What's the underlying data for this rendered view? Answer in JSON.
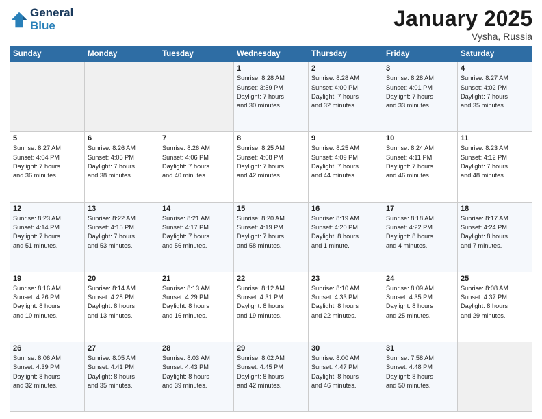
{
  "logo": {
    "line1": "General",
    "line2": "Blue"
  },
  "title": "January 2025",
  "subtitle": "Vysha, Russia",
  "days_header": [
    "Sunday",
    "Monday",
    "Tuesday",
    "Wednesday",
    "Thursday",
    "Friday",
    "Saturday"
  ],
  "weeks": [
    [
      {
        "day": "",
        "info": ""
      },
      {
        "day": "",
        "info": ""
      },
      {
        "day": "",
        "info": ""
      },
      {
        "day": "1",
        "info": "Sunrise: 8:28 AM\nSunset: 3:59 PM\nDaylight: 7 hours\nand 30 minutes."
      },
      {
        "day": "2",
        "info": "Sunrise: 8:28 AM\nSunset: 4:00 PM\nDaylight: 7 hours\nand 32 minutes."
      },
      {
        "day": "3",
        "info": "Sunrise: 8:28 AM\nSunset: 4:01 PM\nDaylight: 7 hours\nand 33 minutes."
      },
      {
        "day": "4",
        "info": "Sunrise: 8:27 AM\nSunset: 4:02 PM\nDaylight: 7 hours\nand 35 minutes."
      }
    ],
    [
      {
        "day": "5",
        "info": "Sunrise: 8:27 AM\nSunset: 4:04 PM\nDaylight: 7 hours\nand 36 minutes."
      },
      {
        "day": "6",
        "info": "Sunrise: 8:26 AM\nSunset: 4:05 PM\nDaylight: 7 hours\nand 38 minutes."
      },
      {
        "day": "7",
        "info": "Sunrise: 8:26 AM\nSunset: 4:06 PM\nDaylight: 7 hours\nand 40 minutes."
      },
      {
        "day": "8",
        "info": "Sunrise: 8:25 AM\nSunset: 4:08 PM\nDaylight: 7 hours\nand 42 minutes."
      },
      {
        "day": "9",
        "info": "Sunrise: 8:25 AM\nSunset: 4:09 PM\nDaylight: 7 hours\nand 44 minutes."
      },
      {
        "day": "10",
        "info": "Sunrise: 8:24 AM\nSunset: 4:11 PM\nDaylight: 7 hours\nand 46 minutes."
      },
      {
        "day": "11",
        "info": "Sunrise: 8:23 AM\nSunset: 4:12 PM\nDaylight: 7 hours\nand 48 minutes."
      }
    ],
    [
      {
        "day": "12",
        "info": "Sunrise: 8:23 AM\nSunset: 4:14 PM\nDaylight: 7 hours\nand 51 minutes."
      },
      {
        "day": "13",
        "info": "Sunrise: 8:22 AM\nSunset: 4:15 PM\nDaylight: 7 hours\nand 53 minutes."
      },
      {
        "day": "14",
        "info": "Sunrise: 8:21 AM\nSunset: 4:17 PM\nDaylight: 7 hours\nand 56 minutes."
      },
      {
        "day": "15",
        "info": "Sunrise: 8:20 AM\nSunset: 4:19 PM\nDaylight: 7 hours\nand 58 minutes."
      },
      {
        "day": "16",
        "info": "Sunrise: 8:19 AM\nSunset: 4:20 PM\nDaylight: 8 hours\nand 1 minute."
      },
      {
        "day": "17",
        "info": "Sunrise: 8:18 AM\nSunset: 4:22 PM\nDaylight: 8 hours\nand 4 minutes."
      },
      {
        "day": "18",
        "info": "Sunrise: 8:17 AM\nSunset: 4:24 PM\nDaylight: 8 hours\nand 7 minutes."
      }
    ],
    [
      {
        "day": "19",
        "info": "Sunrise: 8:16 AM\nSunset: 4:26 PM\nDaylight: 8 hours\nand 10 minutes."
      },
      {
        "day": "20",
        "info": "Sunrise: 8:14 AM\nSunset: 4:28 PM\nDaylight: 8 hours\nand 13 minutes."
      },
      {
        "day": "21",
        "info": "Sunrise: 8:13 AM\nSunset: 4:29 PM\nDaylight: 8 hours\nand 16 minutes."
      },
      {
        "day": "22",
        "info": "Sunrise: 8:12 AM\nSunset: 4:31 PM\nDaylight: 8 hours\nand 19 minutes."
      },
      {
        "day": "23",
        "info": "Sunrise: 8:10 AM\nSunset: 4:33 PM\nDaylight: 8 hours\nand 22 minutes."
      },
      {
        "day": "24",
        "info": "Sunrise: 8:09 AM\nSunset: 4:35 PM\nDaylight: 8 hours\nand 25 minutes."
      },
      {
        "day": "25",
        "info": "Sunrise: 8:08 AM\nSunset: 4:37 PM\nDaylight: 8 hours\nand 29 minutes."
      }
    ],
    [
      {
        "day": "26",
        "info": "Sunrise: 8:06 AM\nSunset: 4:39 PM\nDaylight: 8 hours\nand 32 minutes."
      },
      {
        "day": "27",
        "info": "Sunrise: 8:05 AM\nSunset: 4:41 PM\nDaylight: 8 hours\nand 35 minutes."
      },
      {
        "day": "28",
        "info": "Sunrise: 8:03 AM\nSunset: 4:43 PM\nDaylight: 8 hours\nand 39 minutes."
      },
      {
        "day": "29",
        "info": "Sunrise: 8:02 AM\nSunset: 4:45 PM\nDaylight: 8 hours\nand 42 minutes."
      },
      {
        "day": "30",
        "info": "Sunrise: 8:00 AM\nSunset: 4:47 PM\nDaylight: 8 hours\nand 46 minutes."
      },
      {
        "day": "31",
        "info": "Sunrise: 7:58 AM\nSunset: 4:48 PM\nDaylight: 8 hours\nand 50 minutes."
      },
      {
        "day": "",
        "info": ""
      }
    ]
  ]
}
